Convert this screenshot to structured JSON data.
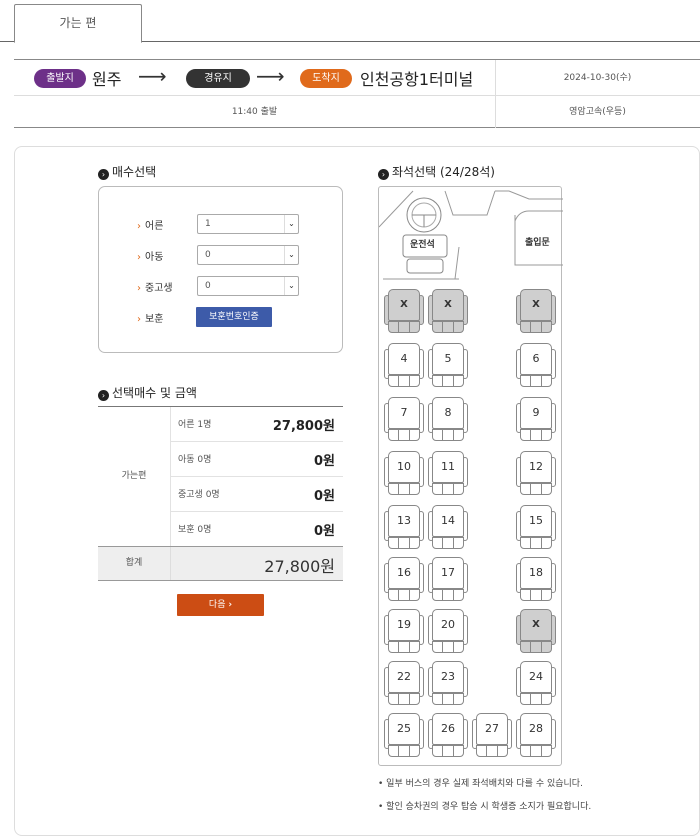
{
  "tab": {
    "label": "가는 편"
  },
  "route": {
    "departure_badge": "출발지",
    "departure": "원주",
    "via_badge": "경유지",
    "arrival_badge": "도착지",
    "arrival": "인천공항1터미널",
    "date": "2024-10-30(수)",
    "departure_time": "11:40 출발",
    "bus_class": "영암고속(우등)"
  },
  "count": {
    "title": "매수선택",
    "rows": [
      {
        "label": "어른",
        "value": "1"
      },
      {
        "label": "아동",
        "value": "0"
      },
      {
        "label": "중고생",
        "value": "0"
      }
    ],
    "veteran_label": "보훈",
    "veteran_button": "보훈번호인증"
  },
  "summary": {
    "title": "선택매수 및 금액",
    "trip_label": "가는편",
    "rows": [
      {
        "label": "어른 1명",
        "amount": "27,800원"
      },
      {
        "label": "아동 0명",
        "amount": "0원"
      },
      {
        "label": "중고생 0명",
        "amount": "0원"
      },
      {
        "label": "보훈 0명",
        "amount": "0원"
      }
    ],
    "total_label": "합계",
    "total_amount": "27,800원",
    "next_button": "다음"
  },
  "seats": {
    "title": "좌석선택 (24/28석)",
    "driver_label": "운전석",
    "door_label": "출입문",
    "list": [
      {
        "label": "X",
        "taken": true
      },
      {
        "label": "X",
        "taken": true
      },
      {
        "label": "X",
        "taken": true
      },
      {
        "label": "4",
        "taken": false
      },
      {
        "label": "5",
        "taken": false
      },
      {
        "label": "6",
        "taken": false
      },
      {
        "label": "7",
        "taken": false
      },
      {
        "label": "8",
        "taken": false
      },
      {
        "label": "9",
        "taken": false
      },
      {
        "label": "10",
        "taken": false
      },
      {
        "label": "11",
        "taken": false
      },
      {
        "label": "12",
        "taken": false
      },
      {
        "label": "13",
        "taken": false
      },
      {
        "label": "14",
        "taken": false
      },
      {
        "label": "15",
        "taken": false
      },
      {
        "label": "16",
        "taken": false
      },
      {
        "label": "17",
        "taken": false
      },
      {
        "label": "18",
        "taken": false
      },
      {
        "label": "19",
        "taken": false
      },
      {
        "label": "20",
        "taken": false
      },
      {
        "label": "X",
        "taken": true
      },
      {
        "label": "22",
        "taken": false
      },
      {
        "label": "23",
        "taken": false
      },
      {
        "label": "24",
        "taken": false
      },
      {
        "label": "25",
        "taken": false
      },
      {
        "label": "26",
        "taken": false
      },
      {
        "label": "27",
        "taken": false
      },
      {
        "label": "28",
        "taken": false
      }
    ]
  },
  "notes": [
    "• 일부 버스의 경우 실제 좌석배치와 다를 수 있습니다.",
    "• 할인 승차권의 경우 탑승 시 학생증 소지가 필요합니다."
  ]
}
